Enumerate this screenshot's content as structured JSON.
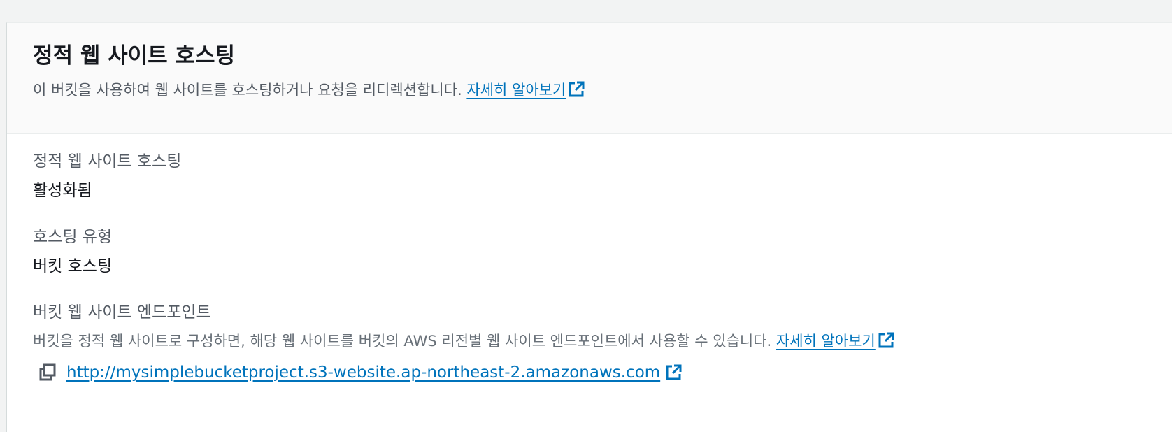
{
  "section": {
    "title": "정적 웹 사이트 호스팅",
    "description": "이 버킷을 사용하여 웹 사이트를 호스팅하거나 요청을 리디렉션합니다.",
    "learn_more": "자세히 알아보기"
  },
  "fields": {
    "hosting": {
      "label": "정적 웹 사이트 호스팅",
      "value": "활성화됨"
    },
    "hosting_type": {
      "label": "호스팅 유형",
      "value": "버킷 호스팅"
    },
    "endpoint": {
      "label": "버킷 웹 사이트 엔드포인트",
      "description": "버킷을 정적 웹 사이트로 구성하면, 해당 웹 사이트를 버킷의 AWS 리전별 웹 사이트 엔드포인트에서 사용할 수 있습니다.",
      "learn_more": "자세히 알아보기",
      "url": "http://mysimplebucketproject.s3-website.ap-northeast-2.amazonaws.com"
    }
  },
  "icons": {
    "external_link": "external-link-icon",
    "copy": "copy-icon"
  },
  "colors": {
    "link": "#0073bb",
    "page_bg": "#f2f3f3",
    "header_bg": "#fafafa"
  }
}
